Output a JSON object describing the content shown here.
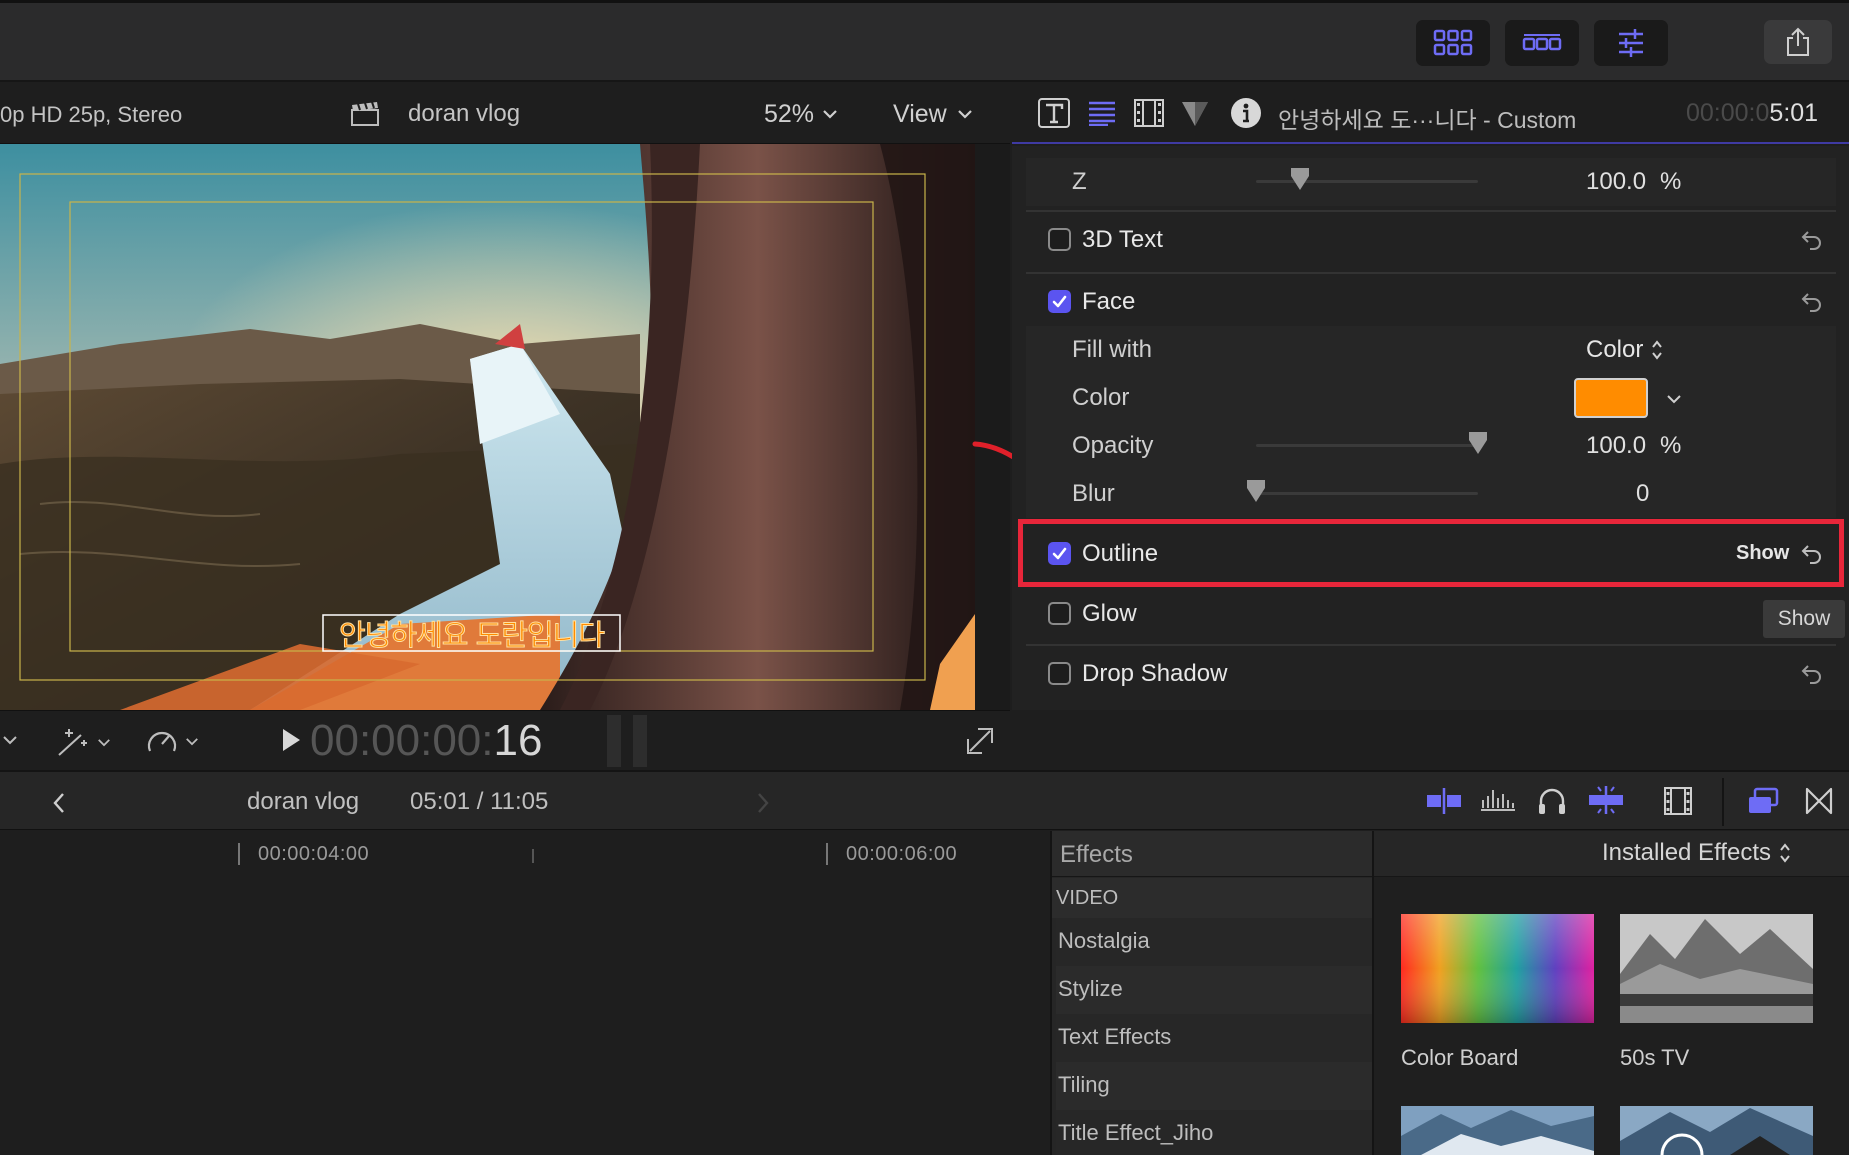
{
  "viewer": {
    "format_text": "0p HD 25p, Stereo",
    "project_name": "doran vlog",
    "zoom": "52%",
    "view_label": "View",
    "subtitle_text": "안녕하세요 도란입니다",
    "timecode_dim": "00:00:00:",
    "timecode_frames": "16"
  },
  "inspector": {
    "title": "안녕하세요 도···니다 - Custom",
    "timecode_dim": "00:00:0",
    "timecode_bright": "5:01",
    "z_label": "Z",
    "z_value": "100.0",
    "z_unit": "%",
    "text3d_label": "3D Text",
    "face_label": "Face",
    "fill_with_label": "Fill with",
    "fill_with_value": "Color",
    "color_label": "Color",
    "face_color": "#ff8c00",
    "opacity_label": "Opacity",
    "opacity_value": "100.0",
    "opacity_unit": "%",
    "blur_label": "Blur",
    "blur_value": "0",
    "outline_label": "Outline",
    "outline_show": "Show",
    "glow_label": "Glow",
    "glow_show": "Show",
    "drop_shadow_label": "Drop Shadow",
    "checkboxes": {
      "text3d": false,
      "face": true,
      "outline": true,
      "glow": false,
      "drop_shadow": false
    },
    "sliders": {
      "z": 0.2,
      "opacity": 1.0,
      "blur": 0.0
    }
  },
  "timeline": {
    "project_name": "doran vlog",
    "position": "05:01 / 11:05",
    "ruler": [
      "00:00:04:00",
      "00:00:06:00"
    ]
  },
  "effects": {
    "title": "Effects",
    "source": "Installed Effects",
    "section": "VIDEO",
    "categories": [
      "Nostalgia",
      "Stylize",
      "Text Effects",
      "Tiling",
      "Title Effect_Jiho"
    ],
    "items": [
      "Color Board",
      "50s TV"
    ]
  },
  "colors": {
    "accent": "#5b54f0",
    "highlight_box": "#e8263a",
    "annotation_arrow": "#e0202a"
  }
}
